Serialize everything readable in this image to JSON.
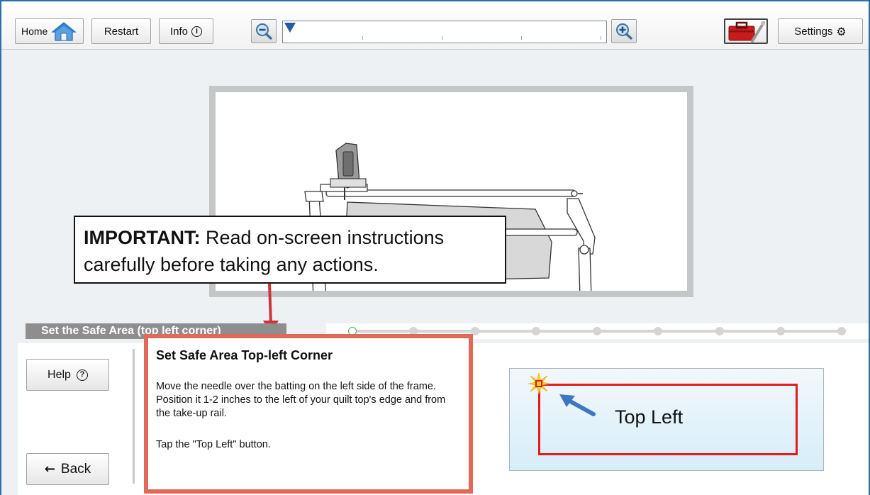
{
  "toolbar": {
    "home_label": "Home",
    "restart_label": "Restart",
    "info_label": "Info",
    "info_icon_glyph": "i",
    "settings_label": "Settings",
    "settings_icon_glyph": "⚙",
    "zoom_out_icon": "zoom-out-icon",
    "zoom_in_icon": "zoom-in-icon",
    "toolbox_icon": "toolbox-icon"
  },
  "callout": {
    "bold_text": "IMPORTANT:",
    "text_line1": " Read on-screen instructions",
    "text_line2": "carefully before taking any actions."
  },
  "step": {
    "label": "Set the Safe Area (top left corner)"
  },
  "progress": {
    "total_steps": 9,
    "current_step": 1
  },
  "sidebar": {
    "help_label": "Help",
    "help_icon_glyph": "?",
    "back_label": "Back",
    "back_icon_glyph": "←"
  },
  "instructions": {
    "title": "Set Safe Area Top-left Corner",
    "body": "Move the needle over the batting on the left side of the frame. Position it 1-2 inches to the left of your quilt top's edge and from the take-up rail.",
    "tap": "Tap the \"Top Left\" button."
  },
  "action": {
    "top_left_label": "Top Left"
  },
  "colors": {
    "accent_border": "#e0695a",
    "arrow": "#d1333b",
    "safe_area": "#e21b1b",
    "frame_border": "#2a6fa8"
  }
}
